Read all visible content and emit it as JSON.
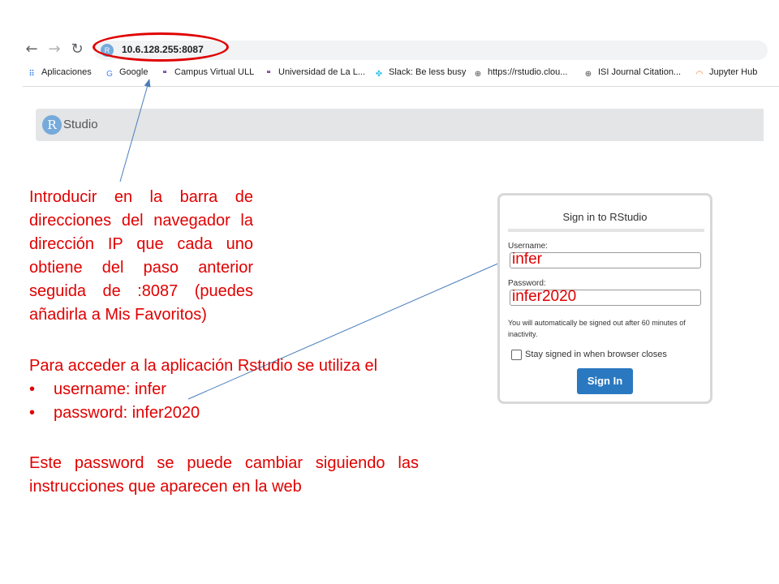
{
  "browser": {
    "url": "10.6.128.255:8087",
    "url_favicon_letter": "R",
    "nav": {
      "back_icon": "arrow-left-icon",
      "forward_icon": "arrow-right-icon",
      "reload_icon": "reload-icon"
    },
    "bookmarks": [
      {
        "label": "Aplicaciones",
        "icon": "apps-grid-icon",
        "icon_glyph": "⠿",
        "color": "#1a73e8"
      },
      {
        "label": "Google",
        "icon": "google-icon",
        "icon_glyph": "G",
        "color": "#4285f4"
      },
      {
        "label": "Campus Virtual ULL",
        "icon": "campus-icon",
        "icon_glyph": "❝",
        "color": "#5b1a8a"
      },
      {
        "label": "Universidad de La L...",
        "icon": "university-icon",
        "icon_glyph": "❝",
        "color": "#5b1a8a"
      },
      {
        "label": "Slack: Be less busy",
        "icon": "slack-icon",
        "icon_glyph": "✤",
        "color": "#36c5f0"
      },
      {
        "label": "https://rstudio.clou...",
        "icon": "globe-icon",
        "icon_glyph": "⊕",
        "color": "#444444"
      },
      {
        "label": "ISI Journal Citation...",
        "icon": "globe-icon",
        "icon_glyph": "⊕",
        "color": "#444444"
      },
      {
        "label": "Jupyter Hub",
        "icon": "jupyter-icon",
        "icon_glyph": "◠",
        "color": "#f37726"
      }
    ]
  },
  "rstudio": {
    "logo_letter": "R",
    "logo_text": "Studio"
  },
  "instructions": "Introducir en la barra de direcciones del navegador la dirección IP que cada uno obtiene del paso anterior seguida de :8087 (puedes añadirla a Mis Favoritos)",
  "access": {
    "title": "Para acceder a la aplicación Rstudio se utiliza el",
    "bullets": [
      "username: infer",
      "password: infer2020"
    ],
    "bullet_char": "•"
  },
  "note": "Este password se puede cambiar siguiendo las instrucciones que aparecen en la web",
  "login": {
    "title": "Sign in to RStudio",
    "username_label": "Username:",
    "username_value": "infer",
    "password_label": "Password:",
    "password_value": "infer2020",
    "signout_note": "You will automatically be signed out after 60 minutes of inactivity.",
    "stay_signed_label": "Stay signed in when browser closes",
    "stay_signed_checked": false,
    "signin_label": "Sign In"
  },
  "colors": {
    "annotation": "#e00000",
    "arrow": "#4a7ebb",
    "button": "#2a78c0"
  }
}
